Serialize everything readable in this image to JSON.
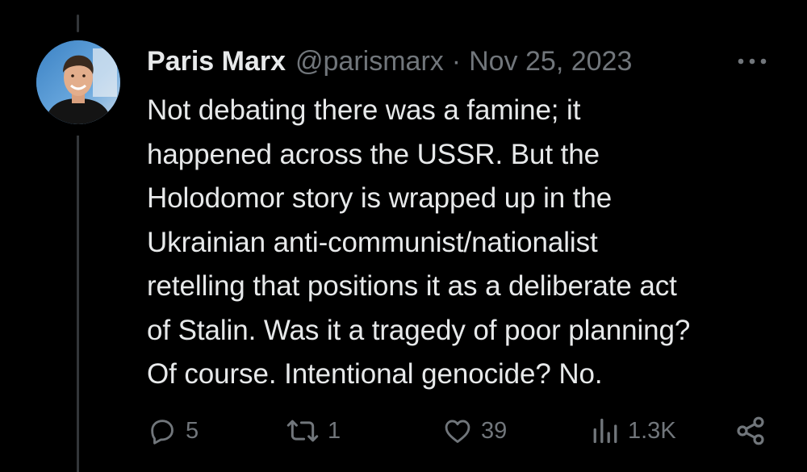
{
  "tweet": {
    "author_name": "Paris Marx",
    "handle": "@parismarx",
    "separator": "·",
    "date": "Nov 25, 2023",
    "text": "Not debating there was a famine; it\nhappened across the USSR. But the\nHolodomor story is wrapped up in the\nUkrainian anti-communist/nationalist\nretelling that positions it as a deliberate act\nof Stalin. Was it a tragedy of poor planning?\nOf course. Intentional genocide? No."
  },
  "actions": {
    "replies": "5",
    "retweets": "1",
    "likes": "39",
    "views": "1.3K"
  },
  "icons": {
    "more": "more-horizontal-icon",
    "reply": "reply-icon",
    "retweet": "retweet-icon",
    "like": "heart-icon",
    "views": "views-chart-icon",
    "share": "share-icon"
  },
  "colors": {
    "background": "#000000",
    "text_primary": "#e7e9ea",
    "text_secondary": "#71767b",
    "thread_line": "#333639"
  }
}
